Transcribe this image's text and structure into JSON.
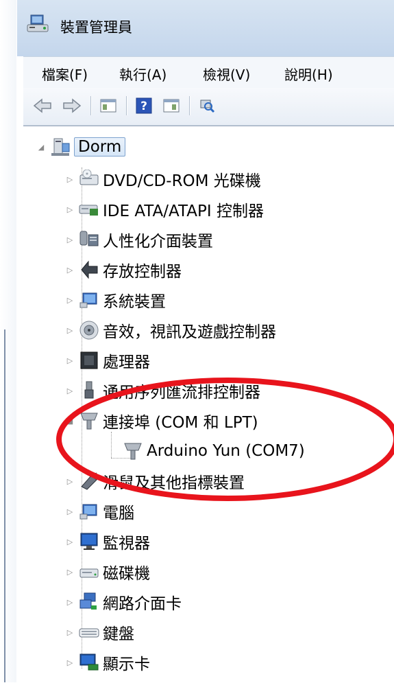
{
  "window": {
    "title": "裝置管理員"
  },
  "menu": [
    {
      "label": "檔案(F)",
      "key": "file"
    },
    {
      "label": "執行(A)",
      "key": "action"
    },
    {
      "label": "檢視(V)",
      "key": "view"
    },
    {
      "label": "說明(H)",
      "key": "help"
    }
  ],
  "toolbar": [
    {
      "icon": "back-arrow-icon"
    },
    {
      "icon": "forward-arrow-icon"
    },
    {
      "icon": "show-hide-console-tree-icon"
    },
    {
      "icon": "help-icon"
    },
    {
      "icon": "properties-icon"
    },
    {
      "icon": "scan-hardware-icon"
    }
  ],
  "tree": {
    "root": "Dorm",
    "items": [
      {
        "label": "DVD/CD-ROM 光碟機",
        "icon": "optical-drive-icon",
        "expanded": false
      },
      {
        "label": "IDE ATA/ATAPI 控制器",
        "icon": "ide-controller-icon",
        "expanded": false
      },
      {
        "label": "人性化介面裝置",
        "icon": "hid-icon",
        "expanded": false
      },
      {
        "label": "存放控制器",
        "icon": "storage-controller-icon",
        "expanded": false
      },
      {
        "label": "系統裝置",
        "icon": "system-devices-icon",
        "expanded": false
      },
      {
        "label": "音效，視訊及遊戲控制器",
        "icon": "sound-icon",
        "expanded": false
      },
      {
        "label": "處理器",
        "icon": "processor-icon",
        "expanded": false
      },
      {
        "label": "通用序列匯流排控制器",
        "icon": "usb-icon",
        "expanded": false
      },
      {
        "label": "連接埠 (COM 和 LPT)",
        "icon": "port-icon",
        "expanded": true,
        "children": [
          {
            "label": "Arduino Yun (COM7)",
            "icon": "port-icon"
          }
        ]
      },
      {
        "label": "滑鼠及其他指標裝置",
        "icon": "mouse-icon",
        "expanded": false
      },
      {
        "label": "電腦",
        "icon": "computer-icon",
        "expanded": false
      },
      {
        "label": "監視器",
        "icon": "monitor-icon",
        "expanded": false
      },
      {
        "label": "磁碟機",
        "icon": "disk-drive-icon",
        "expanded": false
      },
      {
        "label": "網路介面卡",
        "icon": "network-adapter-icon",
        "expanded": false
      },
      {
        "label": "鍵盤",
        "icon": "keyboard-icon",
        "expanded": false
      },
      {
        "label": "顯示卡",
        "icon": "display-adapter-icon",
        "expanded": false
      }
    ]
  },
  "colors": {
    "highlight_ellipse": "#e8141c",
    "frame": "#dfe9f5",
    "selection_border": "#7da2ce"
  }
}
